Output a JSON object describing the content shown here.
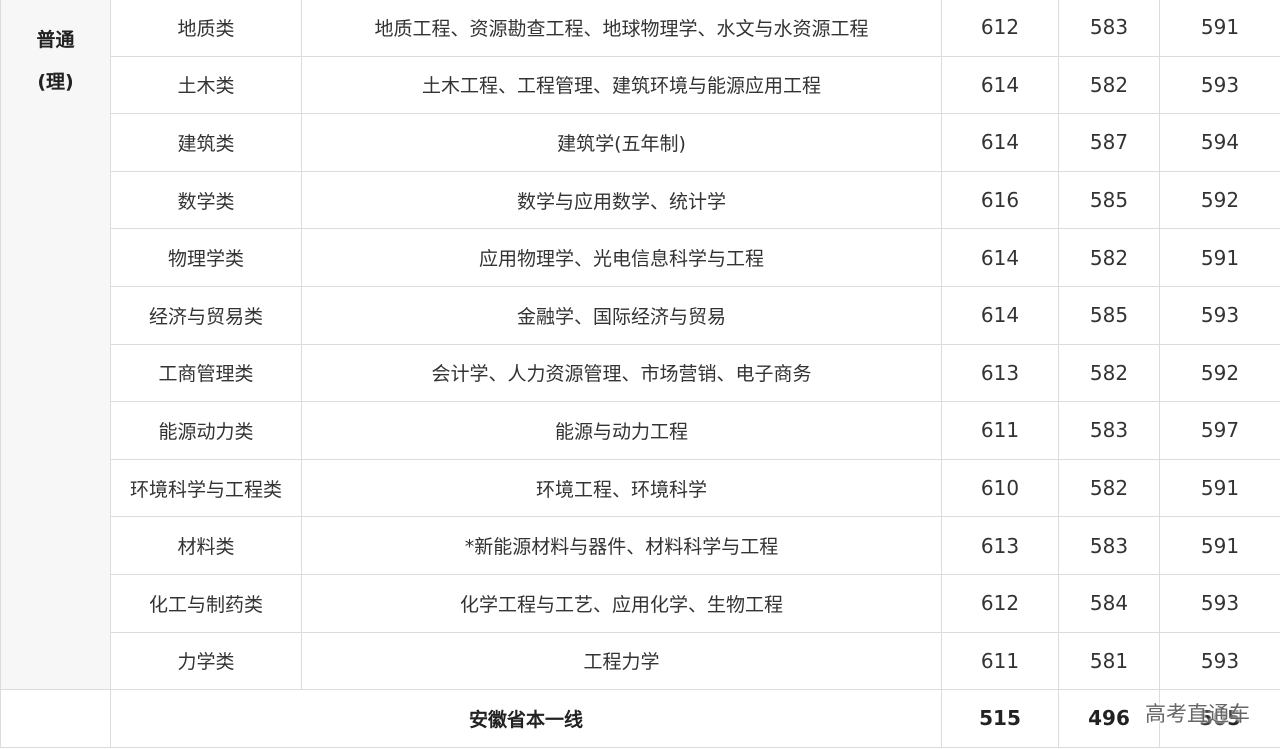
{
  "group_label_line1": "普通",
  "group_label_line2": "(理)",
  "rows": [
    {
      "category": "地质类",
      "majors": "地质工程、资源勘查工程、地球物理学、水文与水资源工程",
      "c1": "612",
      "c2": "583",
      "c3": "591"
    },
    {
      "category": "土木类",
      "majors": "土木工程、工程管理、建筑环境与能源应用工程",
      "c1": "614",
      "c2": "582",
      "c3": "593"
    },
    {
      "category": "建筑类",
      "majors": "建筑学(五年制)",
      "c1": "614",
      "c2": "587",
      "c3": "594"
    },
    {
      "category": "数学类",
      "majors": "数学与应用数学、统计学",
      "c1": "616",
      "c2": "585",
      "c3": "592"
    },
    {
      "category": "物理学类",
      "majors": "应用物理学、光电信息科学与工程",
      "c1": "614",
      "c2": "582",
      "c3": "591"
    },
    {
      "category": "经济与贸易类",
      "majors": "金融学、国际经济与贸易",
      "c1": "614",
      "c2": "585",
      "c3": "593"
    },
    {
      "category": "工商管理类",
      "majors": "会计学、人力资源管理、市场营销、电子商务",
      "c1": "613",
      "c2": "582",
      "c3": "592"
    },
    {
      "category": "能源动力类",
      "majors": "能源与动力工程",
      "c1": "611",
      "c2": "583",
      "c3": "597"
    },
    {
      "category": "环境科学与工程类",
      "majors": "环境工程、环境科学",
      "c1": "610",
      "c2": "582",
      "c3": "591"
    },
    {
      "category": "材料类",
      "majors": "*新能源材料与器件、材料科学与工程",
      "c1": "613",
      "c2": "583",
      "c3": "591"
    },
    {
      "category": "化工与制药类",
      "majors": "化学工程与工艺、应用化学、生物工程",
      "c1": "612",
      "c2": "584",
      "c3": "593"
    },
    {
      "category": "力学类",
      "majors": "工程力学",
      "c1": "611",
      "c2": "581",
      "c3": "593"
    }
  ],
  "footer": {
    "label": "安徽省本一线",
    "c1": "515",
    "c2": "496",
    "c3": "505"
  },
  "watermark": "高考直通车"
}
